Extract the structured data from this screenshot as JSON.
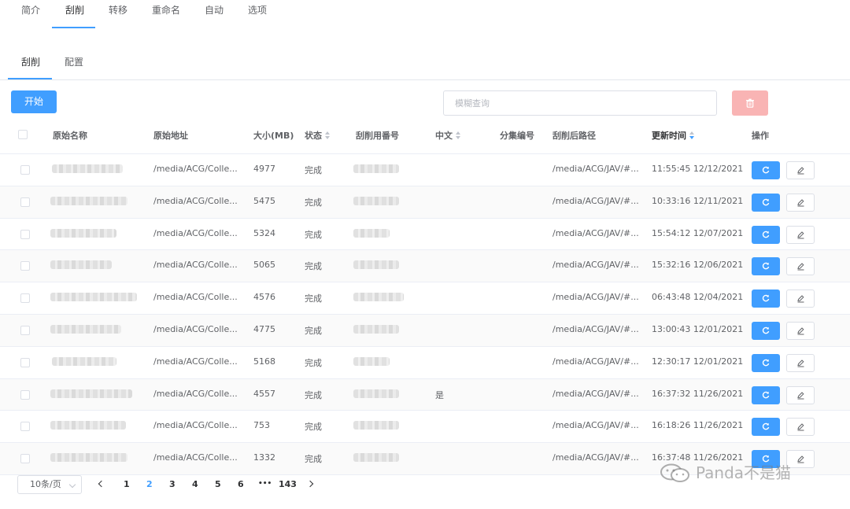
{
  "top_tabs": [
    "简介",
    "刮削",
    "转移",
    "重命名",
    "自动",
    "选项"
  ],
  "sub_tabs": [
    "刮削",
    "配置"
  ],
  "toolbar": {
    "start_label": "开始",
    "search_placeholder": "模糊查询",
    "delete_icon": "trash-icon"
  },
  "table": {
    "headers": {
      "name": "原始名称",
      "path": "原始地址",
      "size": "大小(MB)",
      "status": "状态",
      "code": "刮削用番号",
      "chinese": "中文",
      "episode": "分集编号",
      "dest": "刮削后路径",
      "updated": "更新时间",
      "actions": "操作"
    },
    "rows": [
      {
        "path": "/media/ACG/Colle...",
        "size": "4977",
        "status": "完成",
        "chinese": "",
        "dest": "/media/ACG/JAV/#...",
        "updated": "11:55:45 12/12/2021"
      },
      {
        "path": "/media/ACG/Colle...",
        "size": "5475",
        "status": "完成",
        "chinese": "",
        "dest": "/media/ACG/JAV/#...",
        "updated": "10:33:16 12/11/2021"
      },
      {
        "path": "/media/ACG/Colle...",
        "size": "5324",
        "status": "完成",
        "chinese": "",
        "dest": "/media/ACG/JAV/#...",
        "updated": "15:54:12 12/07/2021"
      },
      {
        "path": "/media/ACG/Colle...",
        "size": "5065",
        "status": "完成",
        "chinese": "",
        "dest": "/media/ACG/JAV/#...",
        "updated": "15:32:16 12/06/2021"
      },
      {
        "path": "/media/ACG/Colle...",
        "size": "4576",
        "status": "完成",
        "chinese": "",
        "dest": "/media/ACG/JAV/#...",
        "updated": "06:43:48 12/04/2021"
      },
      {
        "path": "/media/ACG/Colle...",
        "size": "4775",
        "status": "完成",
        "chinese": "",
        "dest": "/media/ACG/JAV/#...",
        "updated": "13:00:43 12/01/2021"
      },
      {
        "path": "/media/ACG/Colle...",
        "size": "5168",
        "status": "完成",
        "chinese": "",
        "dest": "/media/ACG/JAV/#...",
        "updated": "12:30:17 12/01/2021"
      },
      {
        "path": "/media/ACG/Colle...",
        "size": "4557",
        "status": "完成",
        "chinese": "是",
        "dest": "/media/ACG/JAV/#...",
        "updated": "16:37:32 11/26/2021"
      },
      {
        "path": "/media/ACG/Colle...",
        "size": "753",
        "status": "完成",
        "chinese": "",
        "dest": "/media/ACG/JAV/#...",
        "updated": "16:18:26 11/26/2021"
      },
      {
        "path": "/media/ACG/Colle...",
        "size": "1332",
        "status": "完成",
        "chinese": "",
        "dest": "/media/ACG/JAV/#...",
        "updated": "16:37:48 11/26/2021"
      }
    ]
  },
  "pagination": {
    "page_size": "10条/页",
    "pages": [
      "1",
      "2",
      "3",
      "4",
      "5",
      "6",
      "•••",
      "143"
    ],
    "current": "2"
  },
  "watermark": "Panda不是猫",
  "colors": {
    "primary": "#409eff",
    "danger_light": "#f9b4b4",
    "border": "#ebeef5"
  }
}
